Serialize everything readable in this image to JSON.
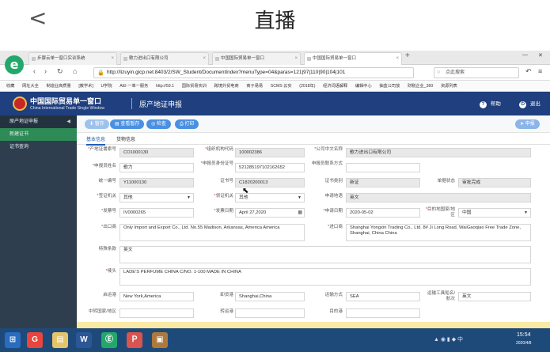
{
  "phone": {
    "back_glyph": "<",
    "title": "直播"
  },
  "browser": {
    "tabs": [
      {
        "label": "步骤云单一窗口实训系统"
      },
      {
        "label": "歌力进出口有限公司"
      },
      {
        "label": "中国国际贸易单一窗口"
      },
      {
        "label": "中国国际贸易单一窗口"
      }
    ],
    "new_tab": "+",
    "url": "http://lizuyin.gicp.net:8403/2/SW_Student/DocumentIndex?menuType=04&paras=121|97|110|90|104|101",
    "search_placeholder": "点此搜索",
    "bookmarks": [
      "收藏",
      "网址大全",
      "制造业高质量",
      "[教学术]",
      "U学院",
      "AEI·一单一服务",
      "http://59.1",
      "国际贸易实训",
      "跨境外贸电商",
      "商子易易",
      "SCMS 云实",
      "(2018年)",
      "经济词语解释",
      "编辑中心",
      "抽盒公司放",
      "财税企业_360",
      "资源列表"
    ]
  },
  "app": {
    "logo_cn": "中国国际贸易单一窗口",
    "logo_en": "China International Trade Single Window",
    "page_title": "原产地证申报",
    "help": "帮助",
    "exit": "退出",
    "help_glyph": "?",
    "exit_glyph": "⏻"
  },
  "sidebar": {
    "section": "原产地证申报",
    "items": [
      {
        "label": "新建证书",
        "active": true
      },
      {
        "label": "证书查询",
        "active": false
      }
    ]
  },
  "toolbar": {
    "buttons": [
      "暂存",
      "查看暂存",
      "检查",
      "打印"
    ],
    "apply": "申报"
  },
  "subtabs": [
    "基本信息",
    "货物信息"
  ],
  "form": {
    "cert_no_label": "产地证書索号",
    "cert_no": "CO1000130",
    "org_code_label": "组织机构代码",
    "org_code": "100002386",
    "company_cn_label": "公司中文名称",
    "company_cn": "歌力进出口有限公司",
    "applicant_label": "申报员姓名",
    "applicant": "歌力",
    "applicant_cert_label": "申报员身份证号",
    "applicant_cert": "521285197102162652",
    "applicant_contact_label": "申报员联系方式",
    "applicant_contact": "",
    "unified_no_label": "统一编号",
    "unified_no": "Y11000130",
    "cert_code_label": "证书号",
    "cert_code": "C1820200013",
    "cert_type_label": "证书类别",
    "cert_type": "新证",
    "status_label": "单据状态",
    "status": "审批完成",
    "visa_org_label": "签证机关",
    "visa_org": "其他",
    "issue_org_label": "领证机关",
    "issue_org": "其他",
    "language_label": "申请地语",
    "language": "英文",
    "invoice_no_label": "发票号",
    "invoice_no": "IV0000265",
    "invoice_date_label": "发票日期",
    "invoice_date": "April 27,2020",
    "apply_date_label": "申请日期",
    "apply_date": "2020-05-02",
    "dest_label": "目的地国家/地区",
    "dest": "中国",
    "exporter_label": "出口商",
    "exporter": "Only Import and Export Co., Ltd. No.55 Madison, Arkansas, America America",
    "importer_label": "进口商",
    "importer": "Shanghai Yongxin Trading Co., Ltd. 8# Ji Long Road, WaiGaoqiao Free Trade Zone, Shanghai, China China",
    "special_label": "特殊条款",
    "special": "英文",
    "marks_label": "唛头",
    "marks": "LADE'S PERFUME CHINA C/NO. 1-100 MADE IN CHINA",
    "start_port_label": "启运港",
    "start_port": "New York,America",
    "unload_port_label": "卸货港",
    "unload_port": "Shanghai,China",
    "transport_label": "运输方式",
    "transport": "SEA",
    "vessel_label": "运输工具船名/航次",
    "vessel": "英文",
    "transit_label": "中转国家/地区",
    "transit_port_label": "转运港",
    "destination_port_label": "目的港"
  },
  "taskbar": {
    "icons": [
      "Ⓔ",
      "G",
      "▤",
      "W",
      "Ⓔ",
      "Ｐ",
      "▣"
    ],
    "tray": "▲ ◉ ▮ ◆ 中",
    "time": "15:54",
    "date": "2020/4/8"
  },
  "colors": {
    "header": "#1f3f7e",
    "sidebar": "#2f3e4e",
    "active": "#2e8b57",
    "button": "#4a90e2",
    "taskbar": "#1e4a7a"
  }
}
